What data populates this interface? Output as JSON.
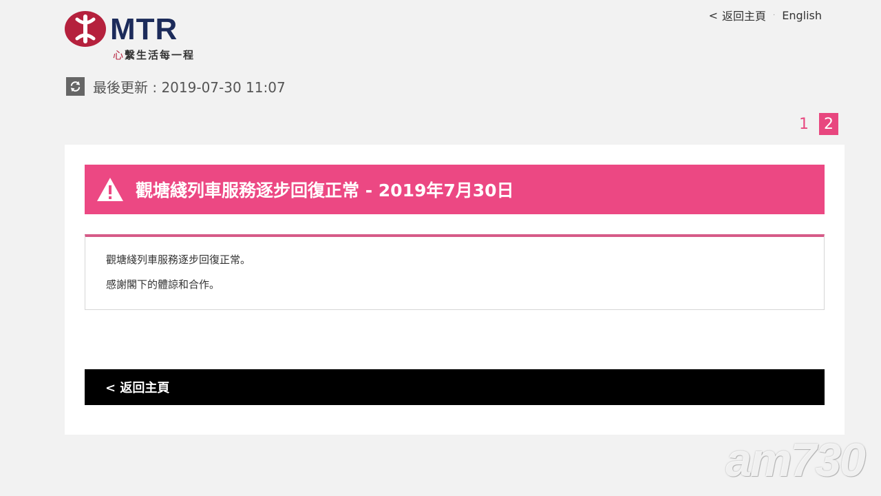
{
  "header": {
    "brand": "MTR",
    "tagline_heart": "心",
    "tagline_rest": "繫生活每一程",
    "nav": {
      "home_label": "返回主頁",
      "home_chevron": "<",
      "separator": "·",
      "language_label": "English"
    }
  },
  "status": {
    "last_updated_label": "最後更新 : 2019-07-30 11:07",
    "icon": "refresh-icon"
  },
  "pagination": {
    "pages": [
      "1",
      "2"
    ],
    "active": "2"
  },
  "alert": {
    "icon": "warning-icon",
    "title": "觀塘綫列車服務逐步回復正常 - 2019年7月30日",
    "messages": [
      "觀塘綫列車服務逐步回復正常。",
      "感謝閣下的體諒和合作。"
    ]
  },
  "footer_nav": {
    "back_label": "< 返回主頁"
  },
  "watermark": {
    "text": "am730"
  },
  "colors": {
    "alert_pink": "#ec4883",
    "brand_red": "#b5213d",
    "brand_navy": "#1c2b5a",
    "page_bg": "#f2f2f2"
  }
}
